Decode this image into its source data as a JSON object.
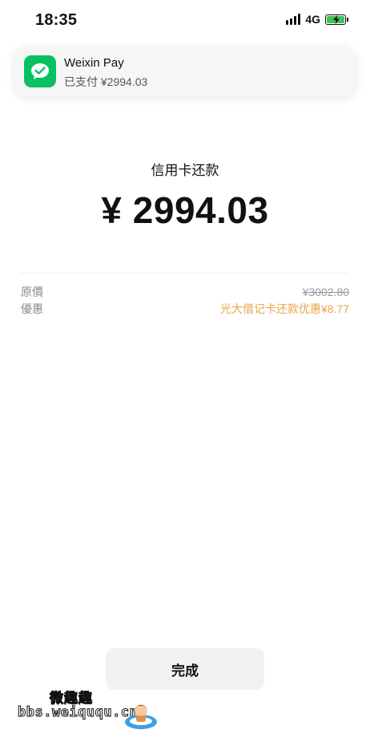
{
  "status_bar": {
    "time": "18:35",
    "network": "4G",
    "icons": [
      "signal-icon",
      "battery-charging-icon"
    ]
  },
  "notification": {
    "app_name": "Weixin Pay",
    "message": "已支付 ¥2994.03",
    "icon": "wechat-pay-icon",
    "icon_color": "#07c160"
  },
  "payment": {
    "title": "信用卡还款",
    "amount": "¥ 2994.03"
  },
  "details": {
    "original_label": "原價",
    "original_value": "¥3002.80",
    "discount_label": "優惠",
    "discount_value": "光大借记卡还款优惠¥8.77",
    "discount_color": "#e9a44a"
  },
  "actions": {
    "done_label": "完成"
  },
  "watermark": {
    "site_name": "微趣趣",
    "url": "bbs.weiququ.cn"
  }
}
